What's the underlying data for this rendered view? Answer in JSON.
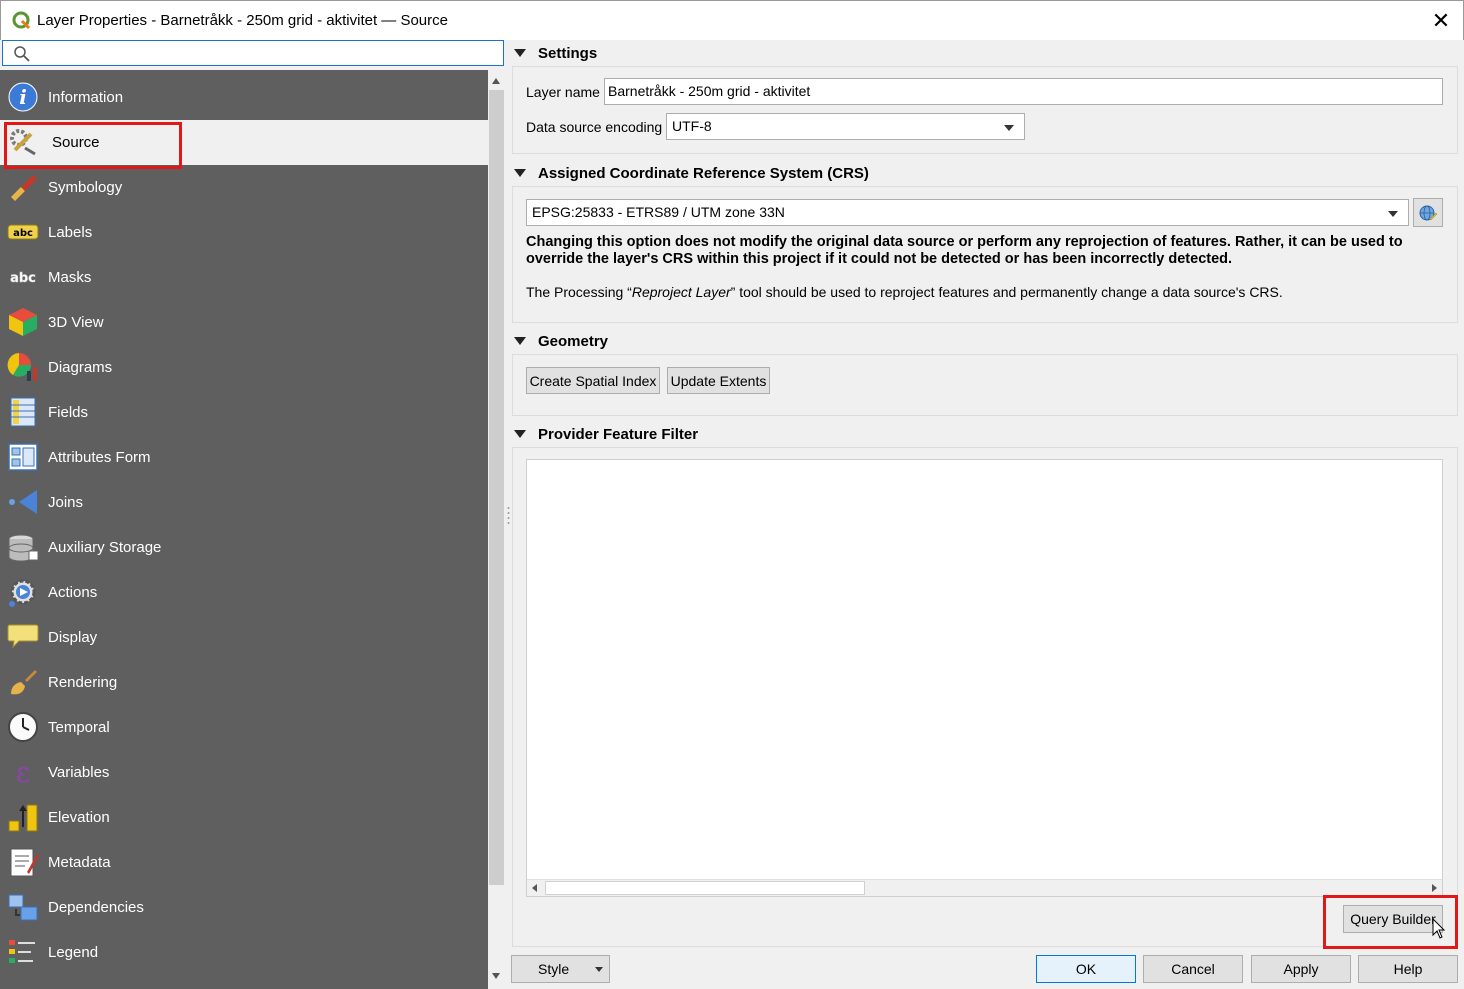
{
  "window": {
    "title": "Layer Properties - Barnetråkk - 250m grid - aktivitet — Source",
    "close_glyph": "✕"
  },
  "search": {
    "placeholder": "",
    "value": ""
  },
  "nav": {
    "items": [
      {
        "label": "Information",
        "icon": "info-icon"
      },
      {
        "label": "Source",
        "icon": "source-icon",
        "selected": true
      },
      {
        "label": "Symbology",
        "icon": "symbology-icon"
      },
      {
        "label": "Labels",
        "icon": "labels-icon"
      },
      {
        "label": "Masks",
        "icon": "masks-icon"
      },
      {
        "label": "3D View",
        "icon": "cube-icon"
      },
      {
        "label": "Diagrams",
        "icon": "diagrams-icon"
      },
      {
        "label": "Fields",
        "icon": "fields-icon"
      },
      {
        "label": "Attributes Form",
        "icon": "form-icon"
      },
      {
        "label": "Joins",
        "icon": "joins-icon"
      },
      {
        "label": "Auxiliary Storage",
        "icon": "database-icon"
      },
      {
        "label": "Actions",
        "icon": "actions-gear-icon"
      },
      {
        "label": "Display",
        "icon": "speech-bubble-icon"
      },
      {
        "label": "Rendering",
        "icon": "paintbrush-icon"
      },
      {
        "label": "Temporal",
        "icon": "clock-icon"
      },
      {
        "label": "Variables",
        "icon": "epsilon-icon"
      },
      {
        "label": "Elevation",
        "icon": "elevation-icon"
      },
      {
        "label": "Metadata",
        "icon": "metadata-icon"
      },
      {
        "label": "Dependencies",
        "icon": "dependencies-icon"
      },
      {
        "label": "Legend",
        "icon": "legend-icon"
      }
    ]
  },
  "settings": {
    "header": "Settings",
    "layer_name_label": "Layer name",
    "layer_name_value": "Barnetråkk - 250m grid - aktivitet",
    "encoding_label": "Data source encoding",
    "encoding_value": "UTF-8"
  },
  "crs": {
    "header": "Assigned Coordinate Reference System (CRS)",
    "value": "EPSG:25833 - ETRS89 / UTM zone 33N",
    "warning": "Changing this option does not modify the original data source or perform any reprojection of features. Rather, it can be used to override the layer's CRS within this project if it could not be detected or has been incorrectly detected.",
    "note_before": "The Processing “",
    "note_italic": "Reproject Layer",
    "note_after": "” tool should be used to reproject features and permanently change a data source's CRS."
  },
  "geometry": {
    "header": "Geometry",
    "create_index_label": "Create Spatial Index",
    "update_extents_label": "Update Extents"
  },
  "filter": {
    "header": "Provider Feature Filter",
    "value": "",
    "query_builder_label": "Query Builder"
  },
  "footer": {
    "style_label": "Style",
    "ok_label": "OK",
    "cancel_label": "Cancel",
    "apply_label": "Apply",
    "help_label": "Help"
  },
  "colors": {
    "nav_bg": "#5f5f5f",
    "highlight": "#e01818",
    "focus": "#1a73c8"
  }
}
